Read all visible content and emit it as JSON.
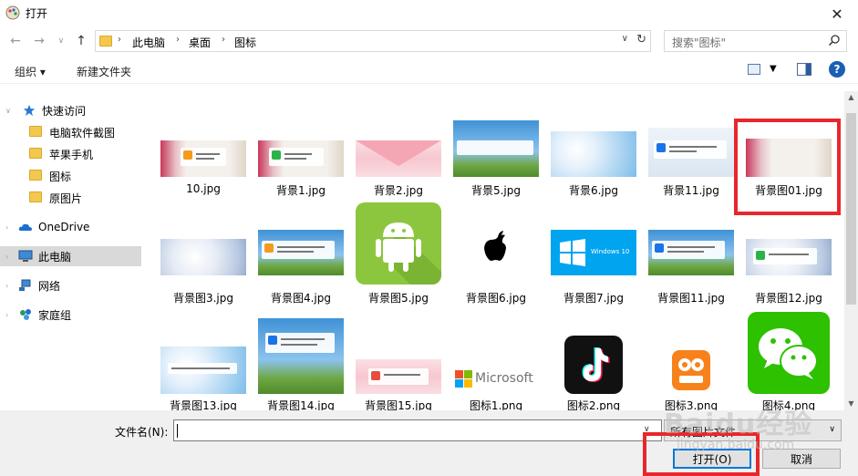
{
  "window": {
    "title": "打开"
  },
  "address": {
    "breadcrumbs": [
      "此电脑",
      "桌面",
      "图标"
    ],
    "search_placeholder": "搜索\"图标\""
  },
  "toolbar": {
    "organize": "组织 ▾",
    "new_folder": "新建文件夹"
  },
  "sidebar": {
    "items": [
      {
        "label": "快速访问"
      },
      {
        "label": "电脑软件截图"
      },
      {
        "label": "苹果手机"
      },
      {
        "label": "图标"
      },
      {
        "label": "原图片"
      },
      {
        "label": "OneDrive"
      },
      {
        "label": "此电脑"
      },
      {
        "label": "网络"
      },
      {
        "label": "家庭组"
      }
    ]
  },
  "files": [
    {
      "name": "10.jpg"
    },
    {
      "name": "背景1.jpg"
    },
    {
      "name": "背景2.jpg"
    },
    {
      "name": "背景5.jpg"
    },
    {
      "name": "背景6.jpg"
    },
    {
      "name": "背景11.jpg"
    },
    {
      "name": "背景图01.jpg"
    },
    {
      "name": "背景图3.jpg"
    },
    {
      "name": "背景图4.jpg"
    },
    {
      "name": "背景图5.jpg"
    },
    {
      "name": "背景图6.jpg"
    },
    {
      "name": "背景图7.jpg"
    },
    {
      "name": "背景图11.jpg"
    },
    {
      "name": "背景图12.jpg"
    },
    {
      "name": "背景图13.jpg"
    },
    {
      "name": "背景图14.jpg"
    },
    {
      "name": "背景图15.jpg"
    },
    {
      "name": "图标1.png"
    },
    {
      "name": "图标2.png"
    },
    {
      "name": "图标3.png"
    },
    {
      "name": "图标4.png"
    }
  ],
  "thumb_text": {
    "microsoft": "Microsoft",
    "windows": "Windows 10"
  },
  "bottom": {
    "filename_label": "文件名(N):",
    "filename_value": "",
    "filetype": "所有图片文件",
    "open_button": "打开(O)",
    "cancel_button": "取消"
  },
  "watermark": {
    "brand": "Baidu经验",
    "url": "jingyan.baidu.com"
  },
  "colors": {
    "highlight": "#e8272c",
    "accent": "#0078d7",
    "selected": "#d9d9d9"
  }
}
